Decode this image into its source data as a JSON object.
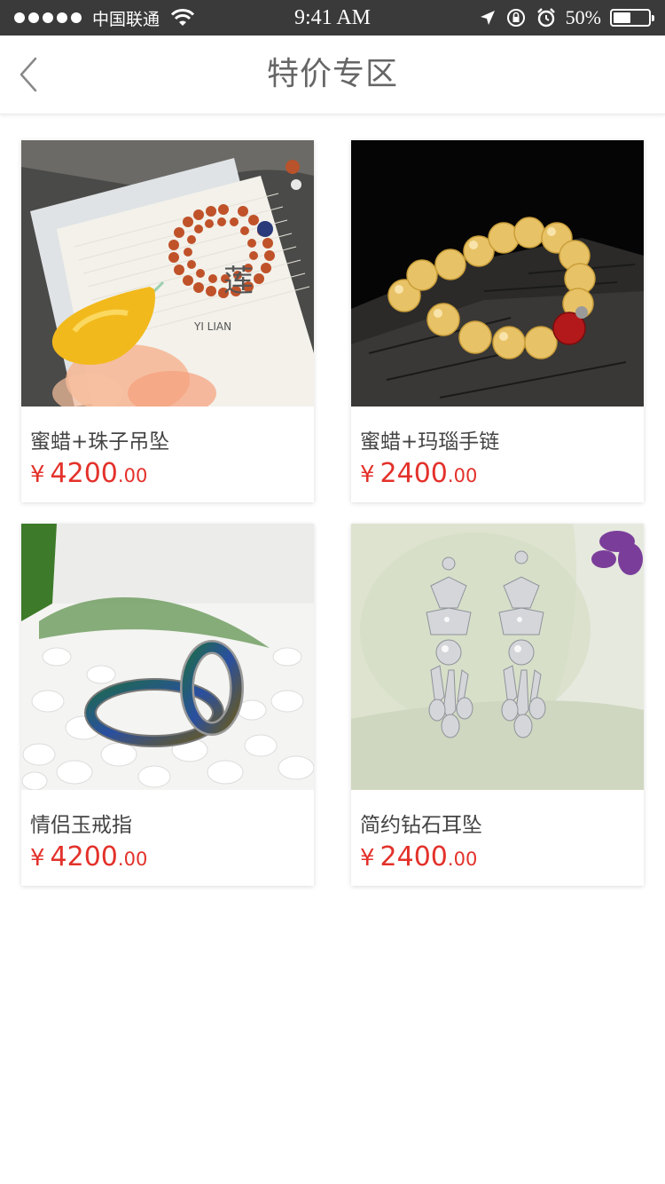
{
  "status_bar": {
    "carrier": "中国联通",
    "time": "9:41 AM",
    "battery": "50%",
    "battery_level": 0.5
  },
  "navbar": {
    "title": "特价专区",
    "back_icon": "chevron-left-icon"
  },
  "products": [
    {
      "name": "蜜蜡+珠子吊坠",
      "currency": "¥",
      "price_int": "4200",
      "price_dec": ".00",
      "image": "amber-pendant-image"
    },
    {
      "name": "蜜蜡+玛瑙手链",
      "currency": "¥",
      "price_int": "2400",
      "price_dec": ".00",
      "image": "amber-bracelet-image"
    },
    {
      "name": "情侣玉戒指",
      "currency": "¥",
      "price_int": "4200",
      "price_dec": ".00",
      "image": "mood-rings-image"
    },
    {
      "name": "简约钻石耳坠",
      "currency": "¥",
      "price_int": "2400",
      "price_dec": ".00",
      "image": "diamond-earrings-image"
    }
  ],
  "colors": {
    "price": "#e3312a",
    "status_bar_bg": "#3a3a3a"
  }
}
